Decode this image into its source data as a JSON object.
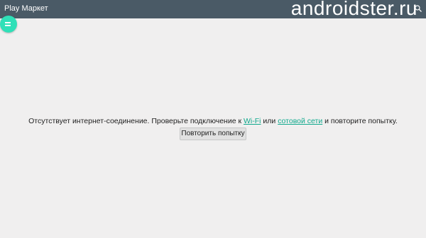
{
  "app": {
    "title": "Play Маркет",
    "watermark": "androidster.ru"
  },
  "icons": {
    "search": "search-icon",
    "menu": "menu-icon"
  },
  "colors": {
    "topbar": "#4a5a66",
    "accent": "#2fe0b8",
    "link": "#11a98d",
    "background": "#f0efef"
  },
  "error": {
    "text_before": "Отсутствует интернет-соединение. Проверьте подключение к ",
    "wifi_link": "Wi-Fi",
    "text_middle": " или ",
    "cellular_link": "сотовой сети",
    "text_after": " и повторите попытку."
  },
  "retry": {
    "label": "Повторить попытку"
  }
}
